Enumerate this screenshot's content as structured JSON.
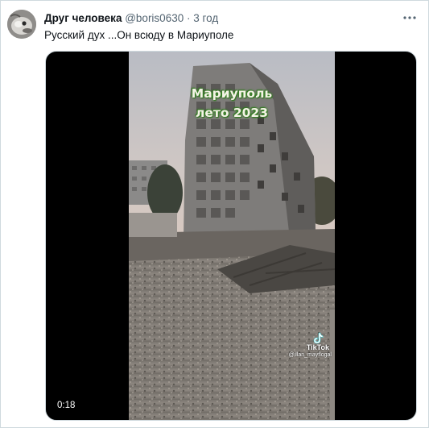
{
  "tweet": {
    "author_name": "Друг человека",
    "handle": "@boris0630",
    "separator": "·",
    "time": "3 год",
    "text": "Русский дух ...Он всюду в Мариуполе"
  },
  "video": {
    "overlay_line1": "Мариуполь",
    "overlay_line2": "лето 2023",
    "watermark_brand": "TikTok",
    "watermark_user": "@illan_mayflogal",
    "duration": "0:18"
  },
  "icons": {
    "more": "more-options-icon",
    "tiktok": "tiktok-logo-icon"
  },
  "colors": {
    "text_primary": "#0f1419",
    "text_secondary": "#536471",
    "border": "#cfd9de",
    "overlay_text": "#f4f3e6",
    "overlay_glow": "#3d8a2a"
  }
}
